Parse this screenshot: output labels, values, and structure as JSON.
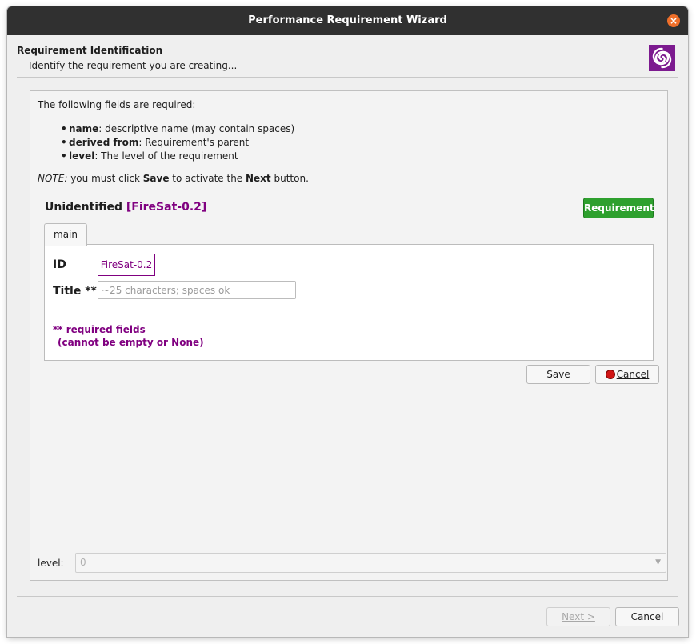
{
  "window": {
    "title": "Performance Requirement Wizard"
  },
  "header": {
    "title": "Requirement Identification",
    "subtitle": "Identify the requirement you are creating..."
  },
  "intro": {
    "text": "The following fields are required:",
    "fields": [
      {
        "name": "name",
        "desc": ": descriptive name (may contain spaces)"
      },
      {
        "name": "derived from",
        "desc": ": Requirement's parent"
      },
      {
        "name": "level",
        "desc": ": The level of the requirement"
      }
    ],
    "note": {
      "prefix": "NOTE:",
      "t1": " you must click ",
      "save": "Save",
      "t2": " to activate the ",
      "next": "Next",
      "t3": " button."
    }
  },
  "object": {
    "name": "Unidentified",
    "id": "[FireSat-0.2]",
    "badge": "Requirement"
  },
  "tabs": [
    {
      "label": "main"
    }
  ],
  "form": {
    "id_label": "ID",
    "id_value": "FireSat-0.2",
    "title_label": "Title **",
    "title_placeholder": "~25 characters; spaces ok",
    "required_line1": "** required fields",
    "required_line2": "(cannot be empty or None)"
  },
  "buttons": {
    "save": "Save",
    "cancel_inner": "Cancel",
    "next": "Next >",
    "cancel": "Cancel"
  },
  "level": {
    "label": "level:",
    "value": "0"
  },
  "colors": {
    "accent_purple": "#800080",
    "badge_green": "#2ea02e",
    "titlebar": "#303030",
    "close": "#ef6f2a"
  }
}
